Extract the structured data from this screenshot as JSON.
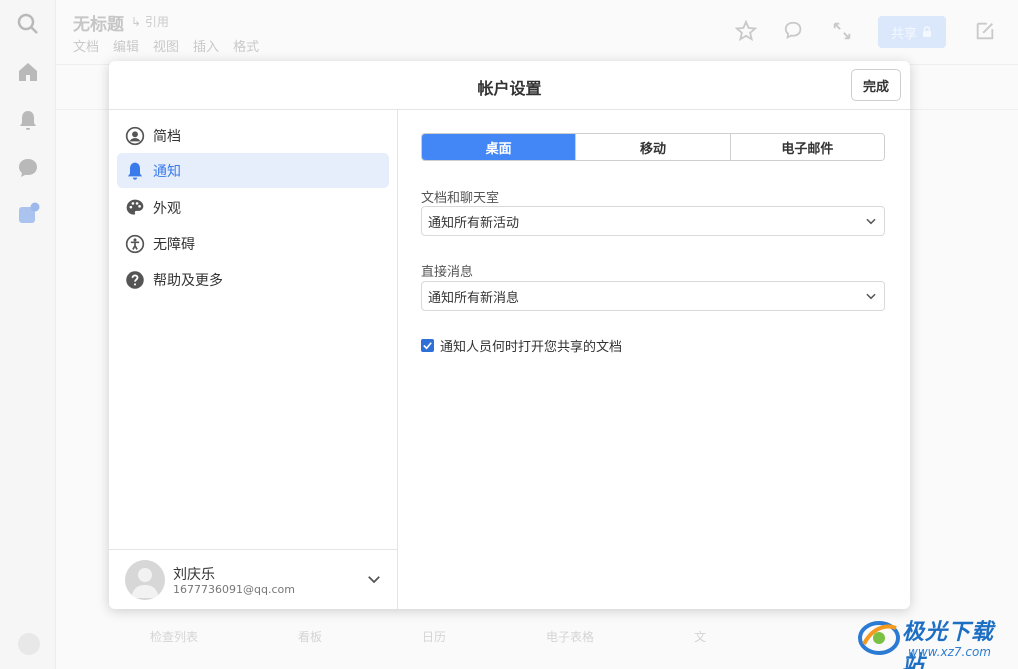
{
  "background": {
    "doc_title": "无标题",
    "cite": "引用",
    "menu": [
      "文档",
      "编辑",
      "视图",
      "插入",
      "格式"
    ],
    "share_label": "共享",
    "bottom_labels": [
      "检查列表",
      "看板",
      "日历",
      "电子表格",
      "文"
    ]
  },
  "modal": {
    "title": "帐户设置",
    "done_label": "完成"
  },
  "sidebar": {
    "items": [
      {
        "label": "简档",
        "icon": "profile-icon"
      },
      {
        "label": "通知",
        "icon": "bell-icon",
        "active": true
      },
      {
        "label": "外观",
        "icon": "palette-icon"
      },
      {
        "label": "无障碍",
        "icon": "accessibility-icon"
      },
      {
        "label": "帮助及更多",
        "icon": "help-icon"
      }
    ],
    "user": {
      "name": "刘庆乐",
      "email": "1677736091@qq.com"
    }
  },
  "tabs": [
    {
      "label": "桌面",
      "active": true
    },
    {
      "label": "移动"
    },
    {
      "label": "电子邮件"
    }
  ],
  "fields": {
    "docs_chat": {
      "label": "文档和聊天室",
      "value": "通知所有新活动"
    },
    "direct": {
      "label": "直接消息",
      "value": "通知所有新消息"
    }
  },
  "checkbox": {
    "label": "通知人员何时打开您共享的文档",
    "checked": true
  },
  "watermark": {
    "name": "极光下载站",
    "url": "www.xz7.com"
  },
  "colors": {
    "accent": "#4287f5",
    "active_bg": "#e6eefb"
  }
}
